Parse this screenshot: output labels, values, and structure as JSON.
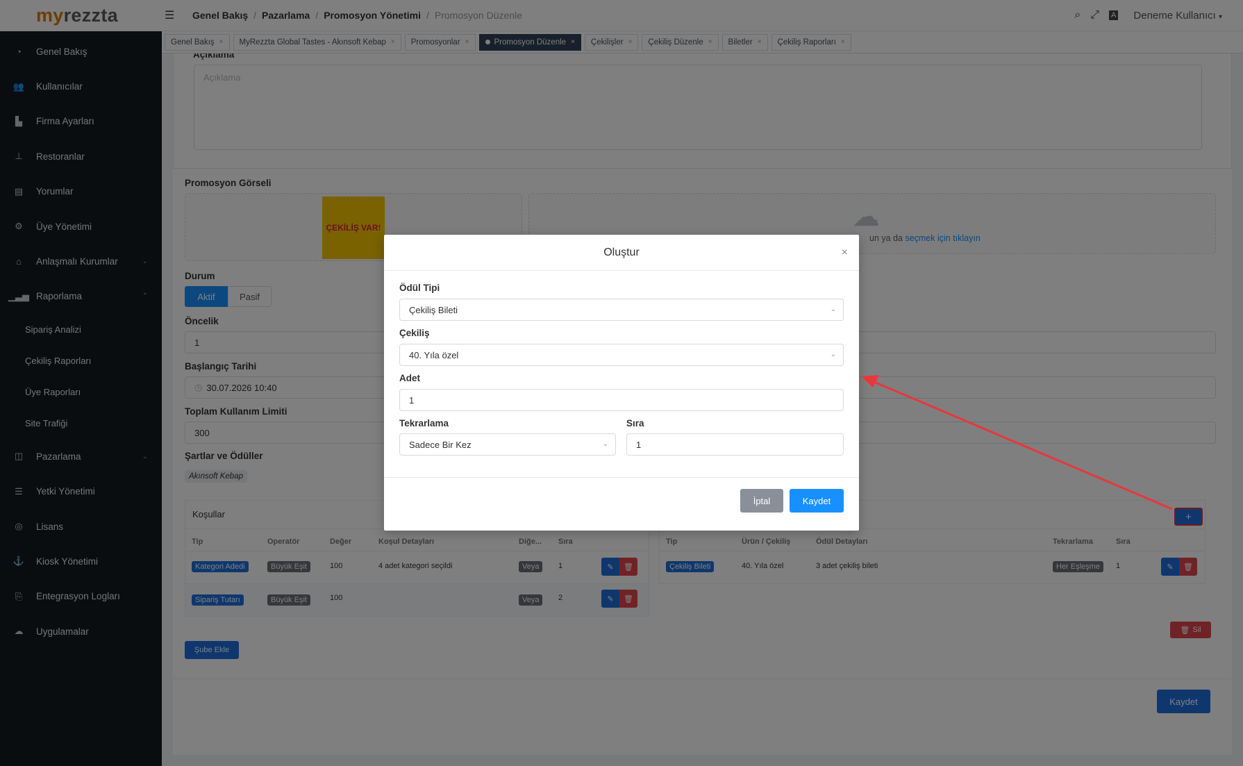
{
  "logo": {
    "part1": "my",
    "part2": "rezzta"
  },
  "sidebar": {
    "items": [
      {
        "label": "Genel Bakış",
        "icon": "dashboard-icon"
      },
      {
        "label": "Kullanıcılar",
        "icon": "users-icon"
      },
      {
        "label": "Firma Ayarları",
        "icon": "building-icon"
      },
      {
        "label": "Restoranlar",
        "icon": "sitemap-icon"
      },
      {
        "label": "Yorumlar",
        "icon": "document-icon"
      },
      {
        "label": "Üye Yönetimi",
        "icon": "gear-icon"
      },
      {
        "label": "Anlaşmalı Kurumlar",
        "icon": "bank-icon"
      },
      {
        "label": "Raporlama",
        "icon": "chart-icon"
      }
    ],
    "sub_items": [
      {
        "label": "Sipariş Analizi"
      },
      {
        "label": "Çekiliş Raporları"
      },
      {
        "label": "Üye Raporları"
      },
      {
        "label": "Site Trafiği"
      }
    ],
    "items2": [
      {
        "label": "Pazarlama",
        "icon": "marketing-icon"
      },
      {
        "label": "Yetki Yönetimi",
        "icon": "list-icon"
      },
      {
        "label": "Lisans",
        "icon": "license-icon"
      },
      {
        "label": "Kiosk Yönetimi",
        "icon": "kiosk-icon"
      },
      {
        "label": "Entegrasyon Logları",
        "icon": "log-icon"
      },
      {
        "label": "Uygulamalar",
        "icon": "cloud-icon"
      }
    ]
  },
  "header": {
    "breadcrumb": [
      "Genel Bakış",
      "Pazarlama",
      "Promosyon Yönetimi",
      "Promosyon Düzenle"
    ],
    "user": "Deneme Kullanıcı"
  },
  "tabs": [
    {
      "label": "Genel Bakış"
    },
    {
      "label": "MyRezzta Global Tastes - Akınsoft Kebap"
    },
    {
      "label": "Promosyonlar"
    },
    {
      "label": "Promosyon Düzenle",
      "active": true
    },
    {
      "label": "Çekilişler"
    },
    {
      "label": "Çekiliş Düzenle"
    },
    {
      "label": "Biletler"
    },
    {
      "label": "Çekiliş Raporları"
    }
  ],
  "form": {
    "aciklama_label": "Açıklama",
    "aciklama_placeholder": "Açıklama",
    "gorsel_label": "Promosyon Görseli",
    "image_caption": "ÇEKİLİŞ VAR!",
    "upload_text_prefix": "un ya da ",
    "upload_link": "seçmek için tıklayın",
    "durum_label": "Durum",
    "durum_aktif": "Aktif",
    "durum_pasif": "Pasif",
    "oncelik_label": "Öncelik",
    "oncelik_value": "1",
    "baslangic_label": "Başlangıç Tarihi",
    "baslangic_value": "30.07.2026 10:40",
    "limit_label": "Toplam Kullanım Limiti",
    "limit_value": "300",
    "sartlar_label": "Şartlar ve Ödüller",
    "sube_tag": "Akınsoft Kebap",
    "kosullar_title": "Koşullar",
    "sube_ekle": "Şube Ekle",
    "sil": "Sil",
    "kaydet": "Kaydet"
  },
  "kosullar_table": {
    "headers": [
      "Tip",
      "Operatör",
      "Değer",
      "Koşul Detayları",
      "Diğe...",
      "Sıra"
    ],
    "rows": [
      {
        "tip": "Kategori Adedi",
        "op": "Büyük Eşit",
        "deger": "100",
        "detay": "4 adet kategori seçildi",
        "diger": "Veya",
        "sira": "1"
      },
      {
        "tip": "Sipariş Tutarı",
        "op": "Büyük Eşit",
        "deger": "100",
        "detay": "",
        "diger": "Veya",
        "sira": "2"
      }
    ]
  },
  "oduller_table": {
    "headers": [
      "Tip",
      "Ürün / Çekiliş",
      "Ödül Detayları",
      "Tekrarlama",
      "Sıra"
    ],
    "rows": [
      {
        "tip": "Çekiliş Bileti",
        "urun": "40. Yıla özel",
        "detay": "3 adet çekiliş bileti",
        "tekrar": "Her Eşleşme",
        "sira": "1"
      }
    ]
  },
  "modal": {
    "title": "Oluştur",
    "odul_tipi_label": "Ödül Tipi",
    "odul_tipi_value": "Çekiliş Bileti",
    "cekilis_label": "Çekiliş",
    "cekilis_value": "40. Yıla özel",
    "adet_label": "Adet",
    "adet_value": "1",
    "tekrarlama_label": "Tekrarlama",
    "tekrarlama_value": "Sadece Bir Kez",
    "sira_label": "Sıra",
    "sira_value": "1",
    "iptal": "İptal",
    "kaydet": "Kaydet"
  },
  "colors": {
    "sidebar_bg": "#141a21",
    "primary": "#1890ff",
    "annotation_red": "#e8373b"
  }
}
